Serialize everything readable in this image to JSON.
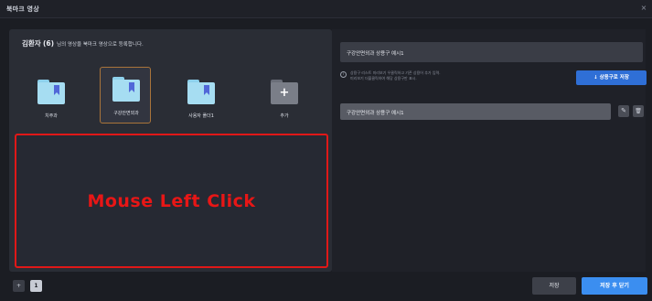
{
  "window": {
    "title": "북마크 영상",
    "close_glyph": "×"
  },
  "heading": {
    "name": "김환자",
    "count": "(6)",
    "rest": "님의 영상을 북마크 영상으로 등록합니다."
  },
  "folders": [
    {
      "label": "치주과",
      "icon": "bookmark-folder-icon",
      "selected": false
    },
    {
      "label": "구강안면외과",
      "icon": "bookmark-folder-icon",
      "selected": true
    },
    {
      "label": "사용자 폴더1",
      "icon": "bookmark-folder-icon",
      "selected": false
    },
    {
      "label": "추가",
      "icon": "add-folder-icon",
      "selected": false
    }
  ],
  "add_glyph": "+",
  "overlay": {
    "text": "Mouse Left Click",
    "color": "#e81616"
  },
  "right": {
    "input_value": "구강안면외과 상용구 예시1",
    "info_line1": "상용구 리스트 미리보기 우클릭하고 기존 상용어 추가 입력.",
    "info_line2": "미리보기 더블클릭하여 해당 상용구만 표시.",
    "save_button": "↓ 상용구로 저장",
    "name_value": "구강안면외과 상용구 예시1",
    "edit_glyph": "✎",
    "delete_glyph": "🗑"
  },
  "pagination": {
    "add_glyph": "+",
    "current": "1"
  },
  "footer": {
    "save": "저장",
    "save_close": "저장 후 닫기"
  },
  "colors": {
    "accent": "#2f6fd6",
    "primary_button": "#3b8ef0",
    "highlight_border": "#e01818",
    "selected_border": "#a9743a"
  }
}
